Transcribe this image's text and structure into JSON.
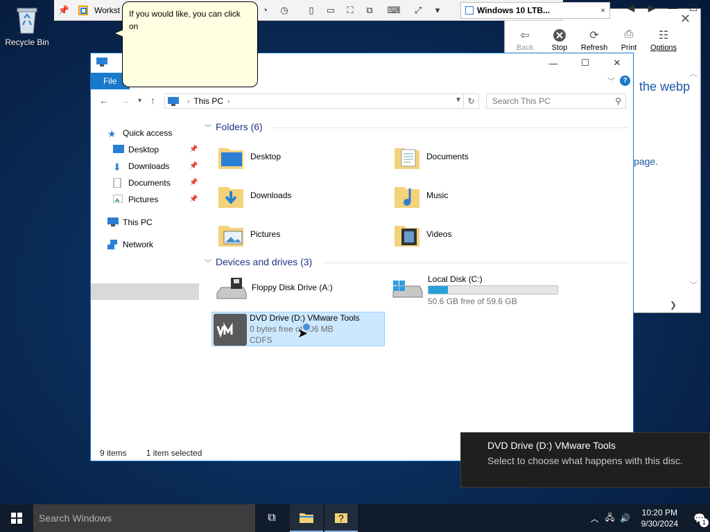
{
  "desktop": {
    "recycle_bin_label": "Recycle Bin"
  },
  "vmware": {
    "title_truncated": "Workst",
    "tab_label": "Windows 10 LTB...",
    "tab_close": "×"
  },
  "help_window": {
    "toolbar": [
      {
        "label": "Back",
        "icon": "back-arrow-icon",
        "disabled": true
      },
      {
        "label": "Stop",
        "icon": "stop-icon",
        "disabled": false
      },
      {
        "label": "Refresh",
        "icon": "refresh-icon",
        "disabled": false
      },
      {
        "label": "Print",
        "icon": "print-icon",
        "disabled": false
      },
      {
        "label": "Options",
        "icon": "options-icon",
        "disabled": false
      }
    ],
    "link_text": "the webp",
    "link_text2": "page."
  },
  "callout": {
    "text": "If you would like, you can click on"
  },
  "explorer": {
    "file_tab": "File",
    "address": {
      "location": "This PC"
    },
    "search_placeholder": "Search This PC",
    "nav_pane": {
      "quick_access": "Quick access",
      "items": [
        {
          "label": "Desktop",
          "pinned": true
        },
        {
          "label": "Downloads",
          "pinned": true
        },
        {
          "label": "Documents",
          "pinned": true
        },
        {
          "label": "Pictures",
          "pinned": true
        }
      ],
      "this_pc": "This PC",
      "network": "Network"
    },
    "folders_header": "Folders (6)",
    "folders": [
      {
        "name": "Desktop"
      },
      {
        "name": "Documents"
      },
      {
        "name": "Downloads"
      },
      {
        "name": "Music"
      },
      {
        "name": "Pictures"
      },
      {
        "name": "Videos"
      }
    ],
    "drives_header": "Devices and drives (3)",
    "drives": [
      {
        "name": "Floppy Disk Drive (A:)"
      },
      {
        "name": "Local Disk (C:)",
        "free_text": "50.6 GB free of 59.6 GB",
        "used_fraction": 0.15
      },
      {
        "name": "DVD Drive (D:) VMware Tools",
        "free_text": "0 bytes free of 106 MB",
        "fs": "CDFS"
      }
    ],
    "status": {
      "items": "9 items",
      "selected": "1 item selected"
    }
  },
  "toast": {
    "title": "DVD Drive (D:) VMware Tools",
    "body": "Select to choose what happens with this disc."
  },
  "taskbar": {
    "search_placeholder": "Search Windows",
    "time": "10:20 PM",
    "date": "9/30/2024",
    "notification_count": "1"
  },
  "colors": {
    "accent": "#1979ca",
    "selection": "#cce8ff",
    "bar_fill": "#26a0da",
    "callout_bg": "#ffffe1"
  }
}
